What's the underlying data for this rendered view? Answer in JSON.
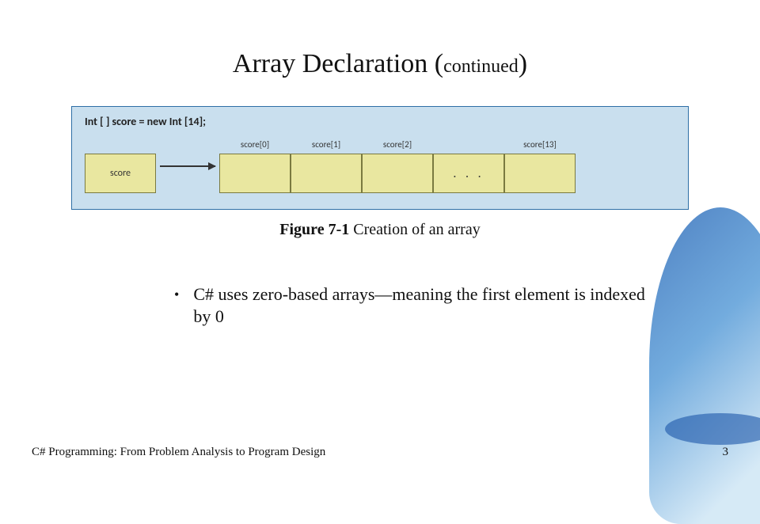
{
  "title_main": "Array Declaration (",
  "title_cont": "continued",
  "title_close": ")",
  "diagram": {
    "code": "Int [ ] score = new Int [14];",
    "score_label": "score",
    "cells": [
      "score[0]",
      "score[1]",
      "score[2]"
    ],
    "ellipsis": ". . .",
    "last_cell": "score[13]"
  },
  "caption": {
    "figno": "Figure 7-1",
    "text": "  Creation of an array"
  },
  "bullet_text": "C# uses zero-based arrays—meaning the first element is indexed by 0",
  "footer_left": "C# Programming: From Problem Analysis to Program Design",
  "footer_right": "3"
}
